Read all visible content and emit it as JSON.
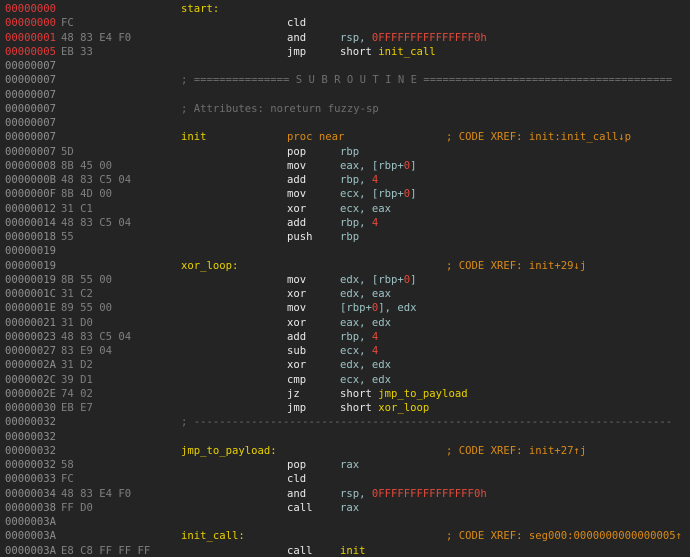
{
  "lines": [
    {
      "addr": "00000000",
      "addr_hl": true,
      "bytes": "",
      "label": "start:"
    },
    {
      "addr": "00000000",
      "addr_hl": true,
      "bytes": "FC",
      "mnem": "cld"
    },
    {
      "addr": "00000001",
      "addr_hl": true,
      "bytes": "48 83 E4 F0",
      "mnem": "and",
      "ops": [
        {
          "t": "rsp, ",
          "c": "reg"
        },
        {
          "t": "0FFFFFFFFFFFFFFF0h",
          "c": "num"
        }
      ]
    },
    {
      "addr": "00000005",
      "addr_hl": true,
      "bytes": "EB 33",
      "mnem": "jmp",
      "ops": [
        {
          "t": "short ",
          "c": "kw"
        },
        {
          "t": "init_call",
          "c": "sym"
        }
      ]
    },
    {
      "addr": "00000007"
    },
    {
      "addr": "00000007",
      "sep": "; =============== S U B R O U T I N E ======================================="
    },
    {
      "addr": "00000007"
    },
    {
      "addr": "00000007",
      "comment": "; Attributes: noreturn fuzzy-sp"
    },
    {
      "addr": "00000007"
    },
    {
      "addr": "00000007",
      "label": "init",
      "procnear": "proc near",
      "xref": "; CODE XREF: init:init_call↓p"
    },
    {
      "addr": "00000007",
      "bytes": "5D",
      "mnem": "pop",
      "ops": [
        {
          "t": "rbp",
          "c": "reg"
        }
      ]
    },
    {
      "addr": "00000008",
      "bytes": "8B 45 00",
      "mnem": "mov",
      "ops": [
        {
          "t": "eax, [rbp+",
          "c": "reg"
        },
        {
          "t": "0",
          "c": "num"
        },
        {
          "t": "]",
          "c": "reg"
        }
      ]
    },
    {
      "addr": "0000000B",
      "bytes": "48 83 C5 04",
      "mnem": "add",
      "ops": [
        {
          "t": "rbp, ",
          "c": "reg"
        },
        {
          "t": "4",
          "c": "num"
        }
      ]
    },
    {
      "addr": "0000000F",
      "bytes": "8B 4D 00",
      "mnem": "mov",
      "ops": [
        {
          "t": "ecx, [rbp+",
          "c": "reg"
        },
        {
          "t": "0",
          "c": "num"
        },
        {
          "t": "]",
          "c": "reg"
        }
      ]
    },
    {
      "addr": "00000012",
      "bytes": "31 C1",
      "mnem": "xor",
      "ops": [
        {
          "t": "ecx, eax",
          "c": "reg"
        }
      ]
    },
    {
      "addr": "00000014",
      "bytes": "48 83 C5 04",
      "mnem": "add",
      "ops": [
        {
          "t": "rbp, ",
          "c": "reg"
        },
        {
          "t": "4",
          "c": "num"
        }
      ]
    },
    {
      "addr": "00000018",
      "bytes": "55",
      "mnem": "push",
      "ops": [
        {
          "t": "rbp",
          "c": "reg"
        }
      ]
    },
    {
      "addr": "00000019"
    },
    {
      "addr": "00000019",
      "label": "xor_loop:",
      "xref": "; CODE XREF: init+29↓j"
    },
    {
      "addr": "00000019",
      "bytes": "8B 55 00",
      "mnem": "mov",
      "ops": [
        {
          "t": "edx, [rbp+",
          "c": "reg"
        },
        {
          "t": "0",
          "c": "num"
        },
        {
          "t": "]",
          "c": "reg"
        }
      ]
    },
    {
      "addr": "0000001C",
      "bytes": "31 C2",
      "mnem": "xor",
      "ops": [
        {
          "t": "edx, eax",
          "c": "reg"
        }
      ]
    },
    {
      "addr": "0000001E",
      "bytes": "89 55 00",
      "mnem": "mov",
      "ops": [
        {
          "t": "[rbp+",
          "c": "reg"
        },
        {
          "t": "0",
          "c": "num"
        },
        {
          "t": "], edx",
          "c": "reg"
        }
      ]
    },
    {
      "addr": "00000021",
      "bytes": "31 D0",
      "mnem": "xor",
      "ops": [
        {
          "t": "eax, edx",
          "c": "reg"
        }
      ]
    },
    {
      "addr": "00000023",
      "bytes": "48 83 C5 04",
      "mnem": "add",
      "ops": [
        {
          "t": "rbp, ",
          "c": "reg"
        },
        {
          "t": "4",
          "c": "num"
        }
      ]
    },
    {
      "addr": "00000027",
      "bytes": "83 E9 04",
      "mnem": "sub",
      "ops": [
        {
          "t": "ecx, ",
          "c": "reg"
        },
        {
          "t": "4",
          "c": "num"
        }
      ]
    },
    {
      "addr": "0000002A",
      "bytes": "31 D2",
      "mnem": "xor",
      "ops": [
        {
          "t": "edx, edx",
          "c": "reg"
        }
      ]
    },
    {
      "addr": "0000002C",
      "bytes": "39 D1",
      "mnem": "cmp",
      "ops": [
        {
          "t": "ecx, edx",
          "c": "reg"
        }
      ]
    },
    {
      "addr": "0000002E",
      "bytes": "74 02",
      "mnem": "jz",
      "ops": [
        {
          "t": "short ",
          "c": "kw"
        },
        {
          "t": "jmp_to_payload",
          "c": "sym"
        }
      ]
    },
    {
      "addr": "00000030",
      "bytes": "EB E7",
      "mnem": "jmp",
      "ops": [
        {
          "t": "short ",
          "c": "kw"
        },
        {
          "t": "xor_loop",
          "c": "sym"
        }
      ]
    },
    {
      "addr": "00000032",
      "sep": "; ---------------------------------------------------------------------------"
    },
    {
      "addr": "00000032"
    },
    {
      "addr": "00000032",
      "label": "jmp_to_payload:",
      "xref": "; CODE XREF: init+27↑j"
    },
    {
      "addr": "00000032",
      "bytes": "58",
      "mnem": "pop",
      "ops": [
        {
          "t": "rax",
          "c": "reg"
        }
      ]
    },
    {
      "addr": "00000033",
      "bytes": "FC",
      "mnem": "cld"
    },
    {
      "addr": "00000034",
      "bytes": "48 83 E4 F0",
      "mnem": "and",
      "ops": [
        {
          "t": "rsp, ",
          "c": "reg"
        },
        {
          "t": "0FFFFFFFFFFFFFFF0h",
          "c": "num"
        }
      ]
    },
    {
      "addr": "00000038",
      "bytes": "FF D0",
      "mnem": "call",
      "ops": [
        {
          "t": "rax",
          "c": "reg"
        }
      ]
    },
    {
      "addr": "0000003A"
    },
    {
      "addr": "0000003A",
      "label": "init_call:",
      "xref": "; CODE XREF: seg000:0000000000000005↑"
    },
    {
      "addr": "0000003A",
      "bytes": "E8 C8 FF FF FF",
      "mnem": "call",
      "ops": [
        {
          "t": "init",
          "c": "sym"
        }
      ]
    }
  ]
}
